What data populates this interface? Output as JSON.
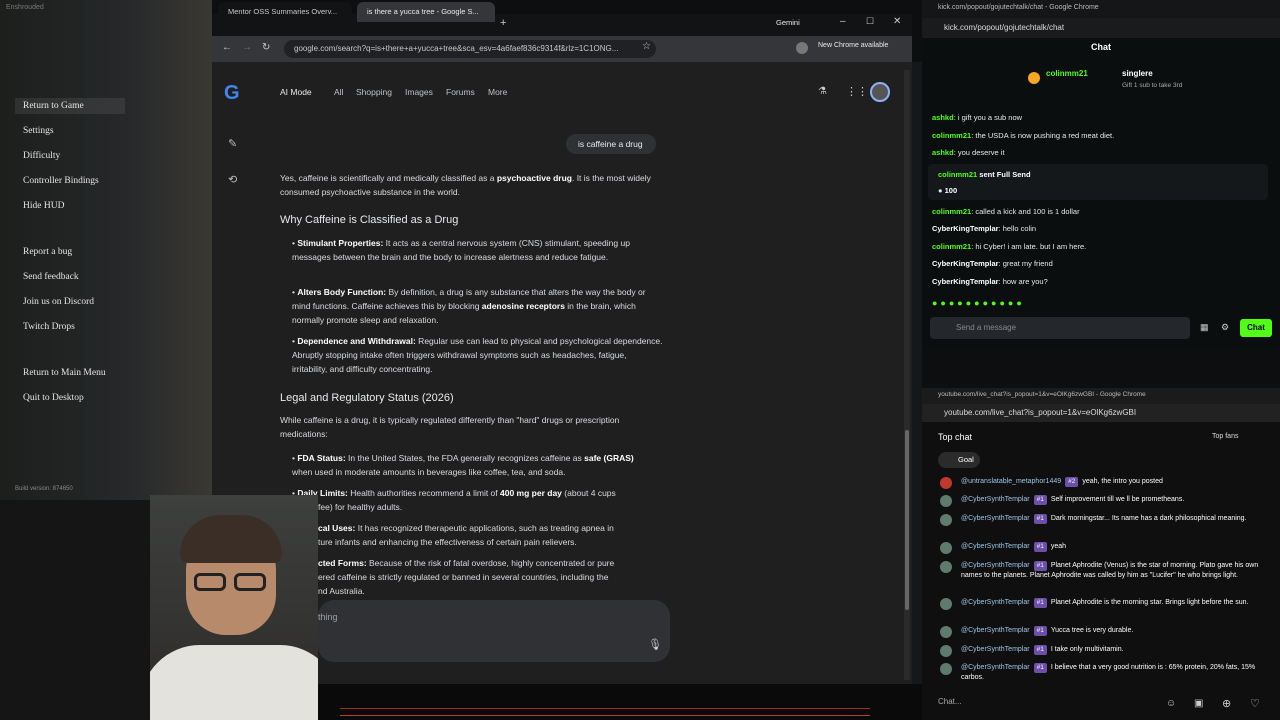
{
  "game": {
    "window_title": "Enshrouded",
    "menu": [
      "Return to Game",
      "Settings",
      "Difficulty",
      "Controller Bindings",
      "Hide HUD"
    ],
    "menu2": [
      "Report a bug",
      "Send feedback",
      "Join us on Discord",
      "Twitch Drops"
    ],
    "menu3": [
      "Return to Main Menu",
      "Quit to Desktop"
    ],
    "build": "Build version: 874650"
  },
  "browser": {
    "tab1": "Mentor OSS Summaries Overv...",
    "tab2": "is there a yucca tree - Google S...",
    "gemini": "Gemini",
    "url": "google.com/search?q=is+there+a+yucca+tree&sca_esv=4a6faef836c9314f&rlz=1C1ONG...",
    "new_chrome": "New Chrome available"
  },
  "google": {
    "logo": "G",
    "nav": [
      "AI Mode",
      "All",
      "Shopping",
      "Images",
      "Forums",
      "More"
    ],
    "query": "is caffeine a drug",
    "intro_pre": "Yes, caffeine is scientifically and medically classified as a ",
    "intro_bold": "psychoactive drug",
    "intro_post": ". It is the most widely consumed psychoactive substance in the world.",
    "h1": "Why Caffeine is Classified as a Drug",
    "b1_t": "Stimulant Properties:",
    "b1": " It acts as a central nervous system (CNS) stimulant, speeding up messages between the brain and the body to increase alertness and reduce fatigue.",
    "b2_t": "Alters Body Function:",
    "b2": " By definition, a drug is any substance that alters the way the body or mind functions. Caffeine achieves this by blocking ",
    "b2_b": "adenosine receptors",
    "b2_post": " in the brain, which normally promote sleep and relaxation.",
    "b3_t": "Dependence and Withdrawal:",
    "b3": " Regular use can lead to physical and psychological dependence. Abruptly stopping intake often triggers withdrawal symptoms such as headaches, fatigue, irritability, and difficulty concentrating.",
    "h2": "Legal and Regulatory Status (2026)",
    "p2": "While caffeine is a drug, it is typically regulated differently than \"hard\" drugs or prescription medications:",
    "c1_t": "FDA Status:",
    "c1": " In the United States, the FDA generally recognizes caffeine as ",
    "c1_b": "safe (GRAS)",
    "c1_post": " when used in moderate amounts in beverages like coffee, tea, and soda.",
    "c2_t": "Daily Limits:",
    "c2": " Health authorities recommend a limit of ",
    "c2_b": "400 mg per day",
    "c2_post": " (about 4 cups",
    "c2_l2": "fee) for healthy adults.",
    "c3_t": "cal Uses:",
    "c3": " It has recognized therapeutic applications, such as treating apnea in",
    "c3_l2": "ture infants and enhancing the effectiveness of certain pain relievers.",
    "c4_t": "cted Forms:",
    "c4": " Because of the risk of fatal overdose, highly concentrated or pure",
    "c4_l2": "ered caffeine is strictly regulated or banned in several countries, including the",
    "c4_l3": "nd Australia.",
    "input": "thing"
  },
  "kick": {
    "title": "kick.com/popout/gojutechtalk/chat - Google Chrome",
    "url": "kick.com/popout/gojutechtalk/chat",
    "chat_title": "Chat",
    "top1": "colinmm21",
    "top2": "singlere",
    "gift": "Gift 1 sub to take 3rd",
    "messages": [
      {
        "n": "ashkd",
        "t": "i gift you a sub now"
      },
      {
        "n": "colinmm21",
        "t": "the USDA is now pushing a red meat diet."
      },
      {
        "n": "ashkd",
        "t": "you deserve it"
      },
      {
        "n": "colinmm21",
        "t": "sent Full Send"
      },
      {
        "n": "",
        "t": "100"
      },
      {
        "n": "colinmm21",
        "t": "called a kick and 100 is 1 dollar"
      },
      {
        "n": "CyberKingTemplar",
        "t": "hello colin"
      },
      {
        "n": "colinmm21",
        "t": "hi Cyber! i am late. but I am here."
      },
      {
        "n": "CyberKingTemplar",
        "t": "great my friend"
      },
      {
        "n": "CyberKingTemplar",
        "t": "how are you?"
      }
    ],
    "input_placeholder": "Send a message",
    "chat_btn": "Chat"
  },
  "youtube": {
    "title": "youtube.com/live_chat?is_popout=1&v=eOlKg6zwGBI - Google Chrome",
    "url": "youtube.com/live_chat?is_popout=1&v=eOlKg6zwGBI",
    "top_chat": "Top chat",
    "top_fans": "Top fans",
    "goal": "Goal",
    "messages": [
      {
        "n": "@untranslatable_metaphor1449",
        "b": "#2",
        "t": "yeah, the intro you posted"
      },
      {
        "n": "@CyberSynthTemplar",
        "b": "#1",
        "t": "Self improvement till we ll be prometheans."
      },
      {
        "n": "@CyberSynthTemplar",
        "b": "#1",
        "t": "Dark morningstar... Its name has a dark philosophical meaning."
      },
      {
        "n": "@CyberSynthTemplar",
        "b": "#1",
        "t": "yeah"
      },
      {
        "n": "@CyberSynthTemplar",
        "b": "#1",
        "t": "Planet Aphrodite (Venus) is the star of morning. Plato gave his own names to the planets. Planet Aphrodite was called by him as \"Lucifer\" he who brings light."
      },
      {
        "n": "@CyberSynthTemplar",
        "b": "#1",
        "t": "Planet Aphrodite is the morning star. Brings light before the sun."
      },
      {
        "n": "@CyberSynthTemplar",
        "b": "#1",
        "t": "Yucca tree is very durable."
      },
      {
        "n": "@CyberSynthTemplar",
        "b": "#1",
        "t": "I take only multivitamin."
      },
      {
        "n": "@CyberSynthTemplar",
        "b": "#1",
        "t": "I believe that a very good nutrition is : 65% protein, 20% fats, 15% carbos."
      }
    ],
    "input": "Chat..."
  }
}
